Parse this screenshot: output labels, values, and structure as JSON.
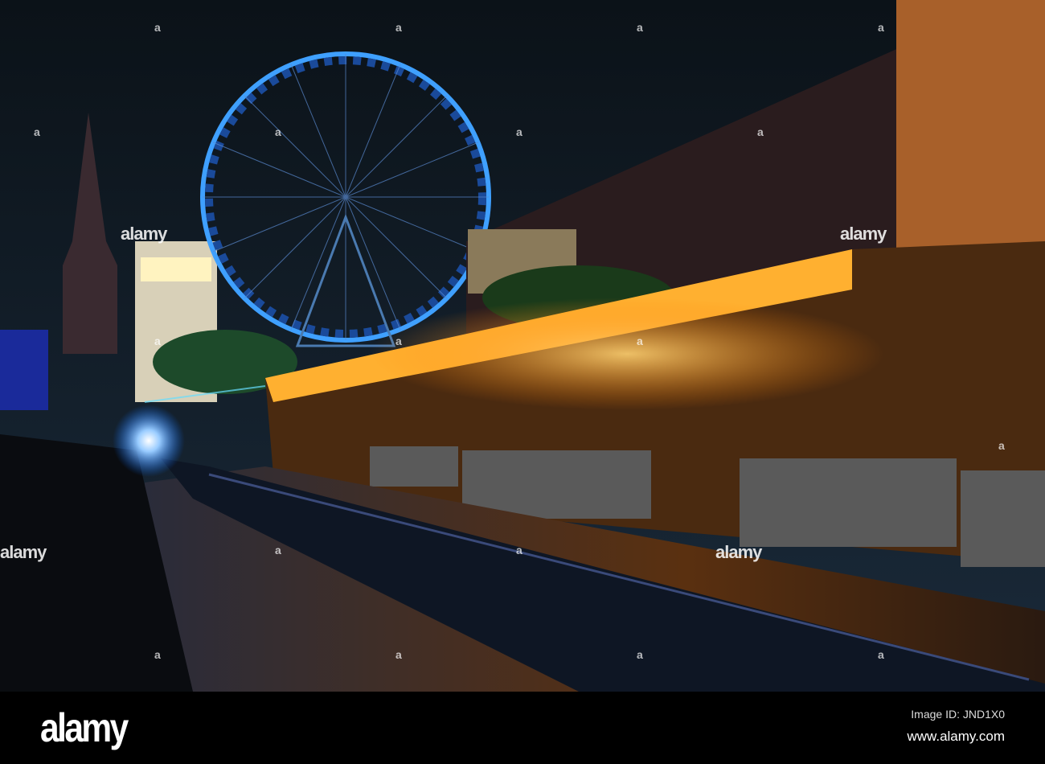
{
  "watermark": {
    "text": "alamy",
    "small_mark": "a"
  },
  "footer": {
    "logo": "alamy",
    "image_id": "Image ID: JND1X0",
    "website": "www.alamy.com"
  },
  "colors": {
    "ferris_wheel": "#3fa0ff",
    "restaurant_light": "#ffb030",
    "sky": "#0e1820"
  }
}
